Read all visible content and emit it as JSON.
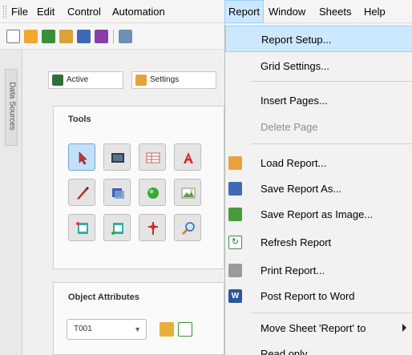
{
  "menubar": {
    "items": [
      {
        "label": "File"
      },
      {
        "label": "Edit"
      },
      {
        "label": "Control"
      },
      {
        "label": "Automation"
      },
      {
        "label": "Report"
      },
      {
        "label": "Window"
      },
      {
        "label": "Sheets"
      },
      {
        "label": "Help"
      }
    ],
    "active_item": "Report"
  },
  "side_panel": {
    "tab_label": "Data Sources"
  },
  "tabs": [
    {
      "label": "Active"
    },
    {
      "label": "Settings"
    }
  ],
  "tools_panel": {
    "title": "Tools"
  },
  "object_attributes_panel": {
    "title": "Object Attributes",
    "selected_object": "T001"
  },
  "report_menu": {
    "items": [
      {
        "label": "Report Setup...",
        "highlighted": true,
        "icon": null
      },
      {
        "label": "Grid Settings...",
        "icon": null
      },
      {
        "label": "Insert Pages...",
        "icon": null
      },
      {
        "label": "Delete Page",
        "disabled": true,
        "icon": null
      },
      {
        "label": "Load Report...",
        "icon": "load-report-icon"
      },
      {
        "label": "Save Report As...",
        "icon": "save-report-icon"
      },
      {
        "label": "Save Report as Image...",
        "icon": "save-image-icon"
      },
      {
        "label": "Refresh Report",
        "icon": "refresh-icon"
      },
      {
        "label": "Print Report...",
        "icon": "printer-icon"
      },
      {
        "label": "Post Report to Word",
        "icon": "word-icon"
      },
      {
        "label": "Move Sheet 'Report' to",
        "submenu": true,
        "icon": null
      },
      {
        "label": "Read only",
        "icon": null
      }
    ]
  },
  "colors": {
    "menu_highlight": "#cce8ff",
    "menu_highlight_border": "#99d1ff",
    "menu_background": "#f2f2f2",
    "tool_selected": "#c5dff7"
  }
}
